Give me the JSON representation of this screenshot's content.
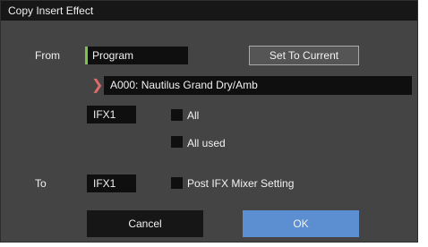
{
  "dialog": {
    "title": "Copy Insert Effect",
    "from_label": "From",
    "source_type": "Program",
    "set_to_current_label": "Set To Current",
    "program_name": "A000: Nautilus Grand Dry/Amb",
    "from_ifx": "IFX1",
    "all_label": "All",
    "all_used_label": "All used",
    "to_label": "To",
    "to_ifx": "IFX1",
    "post_ifx_label": "Post IFX Mixer Setting",
    "cancel_label": "Cancel",
    "ok_label": "OK",
    "icons": {
      "program_chevron": "chevron-right-icon"
    },
    "colors": {
      "accent": "#7cc34e",
      "ok_button": "#5b8fd1",
      "chevron": "#e06a6a"
    },
    "checkboxes": {
      "all": false,
      "all_used": false,
      "post_ifx": false
    }
  }
}
